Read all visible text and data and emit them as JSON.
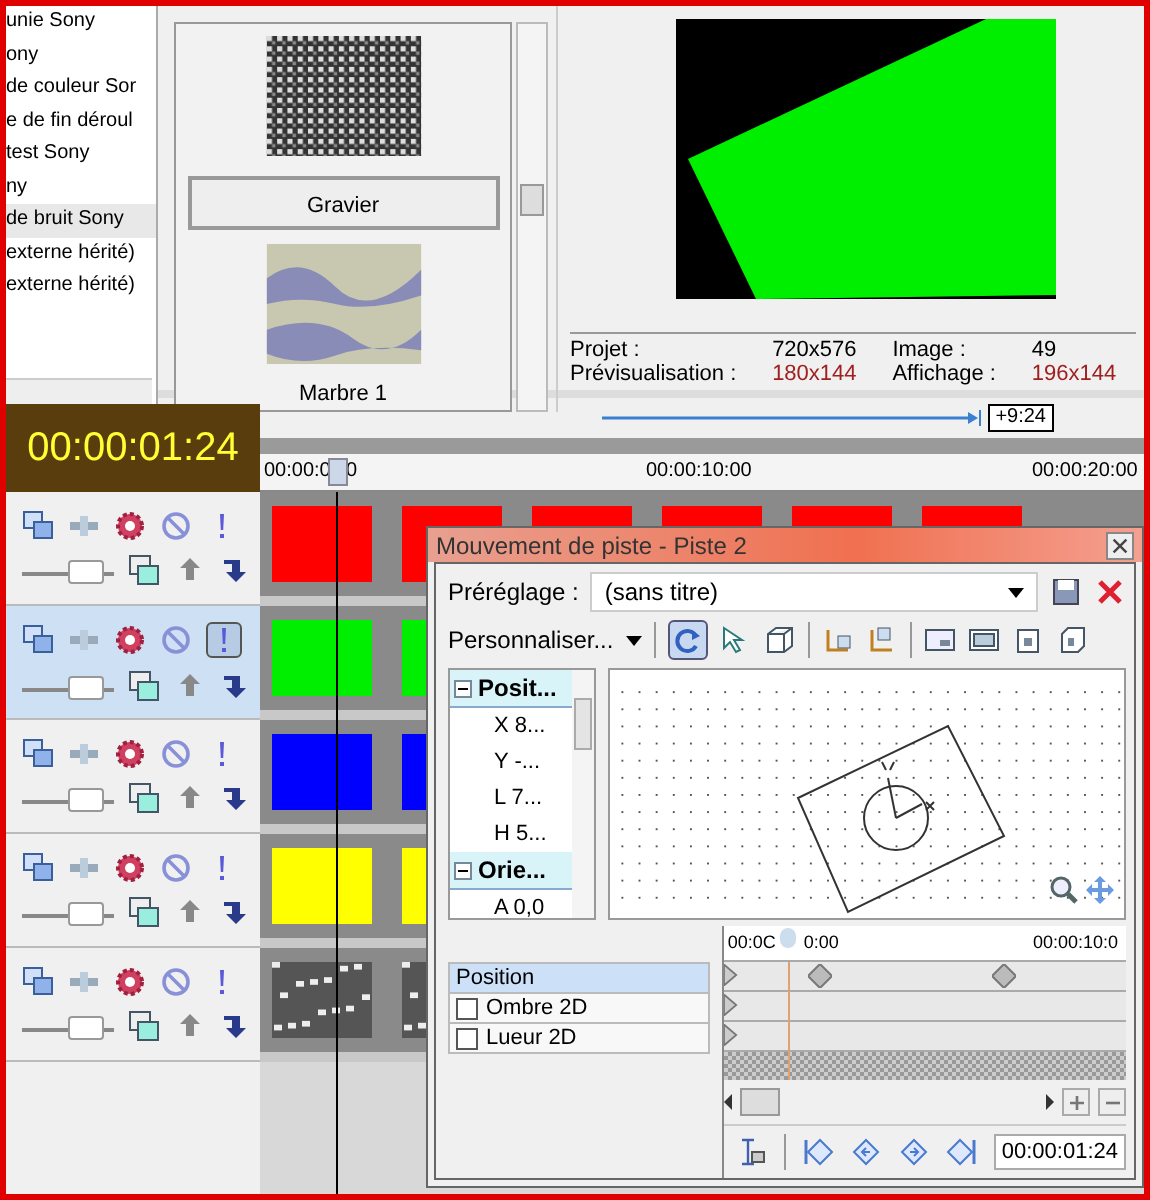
{
  "media_list": {
    "items": [
      {
        "label": "unie Sony",
        "selected": false
      },
      {
        "label": "ony",
        "selected": false
      },
      {
        "label": "de couleur Sor",
        "selected": false
      },
      {
        "label": "e de fin déroul",
        "selected": false
      },
      {
        "label": "test Sony",
        "selected": false
      },
      {
        "label": "ny",
        "selected": false
      },
      {
        "label": "de bruit Sony",
        "selected": true
      },
      {
        "label": "externe hérité)",
        "selected": false
      },
      {
        "label": "externe hérité)",
        "selected": false
      }
    ]
  },
  "presets": {
    "items": [
      {
        "label": "Gravier",
        "selected": true,
        "kind": "noise"
      },
      {
        "label": "Marbre 1",
        "selected": false,
        "kind": "marble"
      }
    ]
  },
  "preview": {
    "info": [
      {
        "label": "Projet :",
        "value": "720x576",
        "highlight": false
      },
      {
        "label": "Image :",
        "value": "49",
        "highlight": false
      },
      {
        "label": "Prévisualisation :",
        "value": "180x144",
        "highlight": true
      },
      {
        "label": "Affichage :",
        "value": "196x144",
        "highlight": true
      }
    ],
    "loop_length": "+9:24"
  },
  "timeline": {
    "timecode": "00:00:01:24",
    "ruler_labels": [
      "00:00:0",
      "0",
      "00:00:10:00",
      "00:00:20:00"
    ],
    "tracks": [
      {
        "kind": "solid",
        "color": "#ff0000",
        "selected": false,
        "exclamation_pressed": false,
        "level": 0.8
      },
      {
        "kind": "solid",
        "color": "#00ee00",
        "selected": true,
        "exclamation_pressed": true,
        "level": 0.8
      },
      {
        "kind": "solid",
        "color": "#0000ff",
        "selected": false,
        "exclamation_pressed": false,
        "level": 0.8
      },
      {
        "kind": "solid",
        "color": "#ffff00",
        "selected": false,
        "exclamation_pressed": false,
        "level": 0.8
      },
      {
        "kind": "noise",
        "selected": false,
        "exclamation_pressed": false,
        "level": 0.8
      }
    ]
  },
  "dialog": {
    "title": "Mouvement de piste - Piste 2",
    "preset_label": "Préréglage :",
    "preset_value": "(sans titre)",
    "customize": "Personnaliser...",
    "tree": [
      {
        "label": "Posit...",
        "expanded": true,
        "children": [
          {
            "label": "X 8..."
          },
          {
            "label": "Y -..."
          },
          {
            "label": "L 7..."
          },
          {
            "label": "H 5..."
          }
        ]
      },
      {
        "label": "Orie...",
        "expanded": true,
        "children": [
          {
            "label": "A 0,0"
          }
        ]
      }
    ],
    "ruler_labels": [
      "00:0C",
      "0:00",
      "00:00:10:0"
    ],
    "rows": [
      {
        "label": "Position",
        "kind": "header",
        "selected": true
      },
      {
        "label": "Ombre 2D",
        "kind": "checkbox",
        "checked": false,
        "selected": false
      },
      {
        "label": "Lueur 2D",
        "kind": "checkbox",
        "checked": false,
        "selected": false
      }
    ],
    "time": "00:00:01:24"
  }
}
